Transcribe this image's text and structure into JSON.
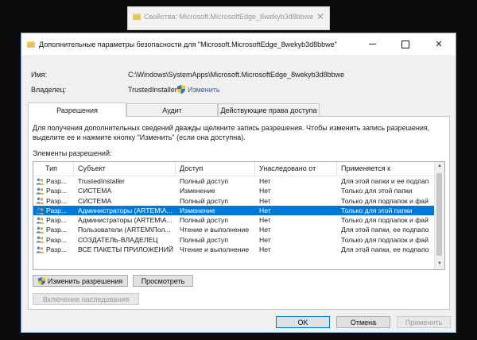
{
  "background_window": {
    "title": "Свойства: Microsoft.MicrosoftEdge_8wekyb3d8bbwe",
    "close_glyph": "✕"
  },
  "window": {
    "title": "Дополнительные параметры безопасности  для \"Microsoft.MicrosoftEdge_8wekyb3d8bbwe\"",
    "minimize": "",
    "close_glyph": "✕"
  },
  "info": {
    "name_label": "Имя:",
    "name_value": "C:\\Windows\\SystemApps\\Microsoft.MicrosoftEdge_8wekyb3d8bbwe",
    "owner_label": "Владелец:",
    "owner_value": "TrustedInstaller",
    "change_link": "Изменить"
  },
  "tabs": [
    {
      "label": "Разрешения",
      "active": true
    },
    {
      "label": "Аудит",
      "active": false
    },
    {
      "label": "Действующие права доступа",
      "active": false
    }
  ],
  "permissions": {
    "description": "Для получения дополнительных сведений дважды щелкните запись разрешения. Чтобы изменить запись разрешения, выделите ее и нажмите кнопку \"Изменить\" (если она доступна).",
    "list_label": "Элементы разрешений:",
    "columns": [
      "Тип",
      "Субъект",
      "Доступ",
      "Унаследовано от",
      "Применяется к"
    ],
    "rows": [
      {
        "type": "Разр...",
        "subject": "TrustedInstaller",
        "access": "Полный доступ",
        "inherited": "Нет",
        "applies": "Для этой папки и ее подпап",
        "selected": false
      },
      {
        "type": "Разр...",
        "subject": "СИСТЕМА",
        "access": "Изменение",
        "inherited": "Нет",
        "applies": "Только для этой папки",
        "selected": false
      },
      {
        "type": "Разр...",
        "subject": "СИСТЕМА",
        "access": "Полный доступ",
        "inherited": "Нет",
        "applies": "Только для подпапок и фай",
        "selected": false
      },
      {
        "type": "Разр...",
        "subject": "Администраторы (ARTEM\\A...",
        "access": "Изменение",
        "inherited": "Нет",
        "applies": "Только для этой папки",
        "selected": true
      },
      {
        "type": "Разр...",
        "subject": "Администраторы (ARTEM\\A...",
        "access": "Полный доступ",
        "inherited": "Нет",
        "applies": "Только для подпапок и фай",
        "selected": false
      },
      {
        "type": "Разр...",
        "subject": "Пользователи (ARTEM\\Пол...",
        "access": "Чтение и выполнение",
        "inherited": "Нет",
        "applies": "Для этой папки, ее подпапо",
        "selected": false
      },
      {
        "type": "Разр...",
        "subject": "СОЗДАТЕЛЬ-ВЛАДЕЛЕЦ",
        "access": "Полный доступ",
        "inherited": "Нет",
        "applies": "Только для подпапок и фай",
        "selected": false
      },
      {
        "type": "Разр...",
        "subject": "ВСЕ ПАКЕТЫ ПРИЛОЖЕНИЙ",
        "access": "Чтение и выполнение",
        "inherited": "Нет",
        "applies": "Для этой папки, ее подпапо",
        "selected": false
      }
    ],
    "change_permissions_button": "Изменить разрешения",
    "view_button": "Просмотреть",
    "enable_inheritance_button": "Включение наследования"
  },
  "footer": {
    "ok": "OK",
    "cancel": "Отмена",
    "apply": "Применить"
  },
  "colors": {
    "selection": "#0078d7",
    "link": "#1e5db5",
    "window_border": "#7aa8d8"
  }
}
